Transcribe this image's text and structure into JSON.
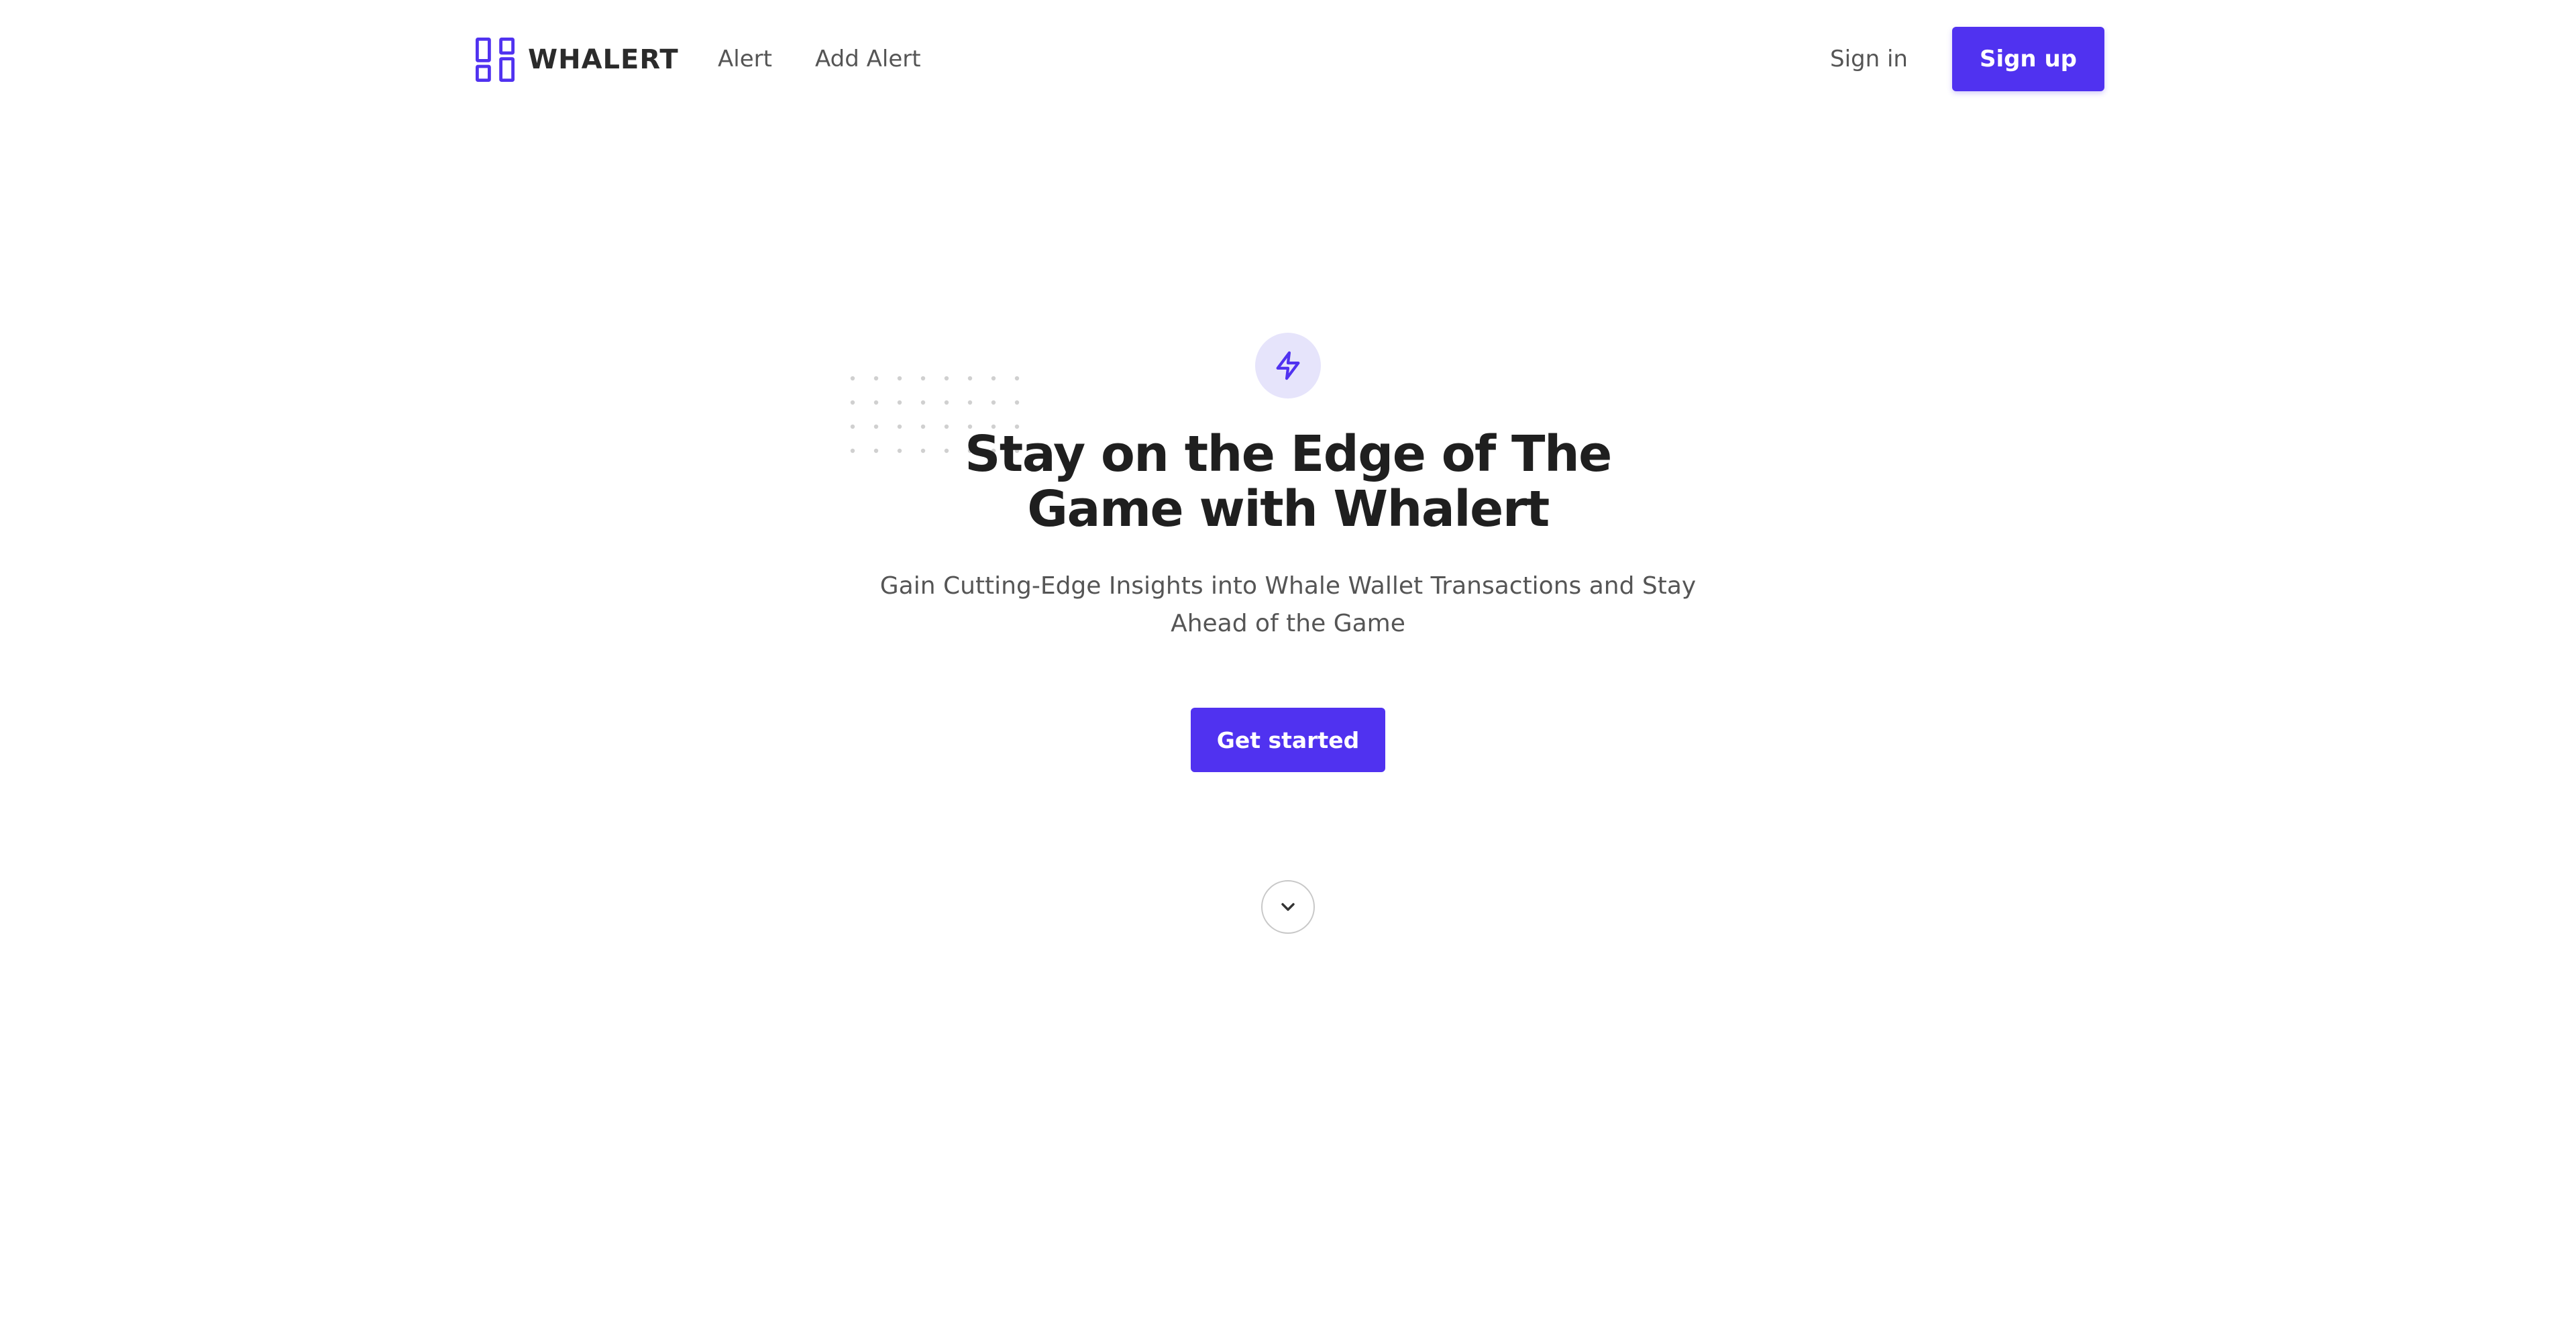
{
  "brand": {
    "name": "WHALERT",
    "icon": "dashboard-grid-icon",
    "accent_color": "#5032f0"
  },
  "nav": {
    "items": [
      {
        "label": "Alert"
      },
      {
        "label": "Add Alert"
      }
    ],
    "sign_in": "Sign in",
    "sign_up": "Sign up"
  },
  "hero": {
    "icon": "lightning-bolt-icon",
    "title_line1": "Stay on the Edge of The",
    "title_line2": "Game with Whalert",
    "subtitle_line1": "Gain Cutting-Edge Insights into Whale Wallet Transactions and Stay",
    "subtitle_line2": "Ahead of the Game",
    "cta_label": "Get started",
    "scroll_icon": "chevron-down-icon"
  }
}
